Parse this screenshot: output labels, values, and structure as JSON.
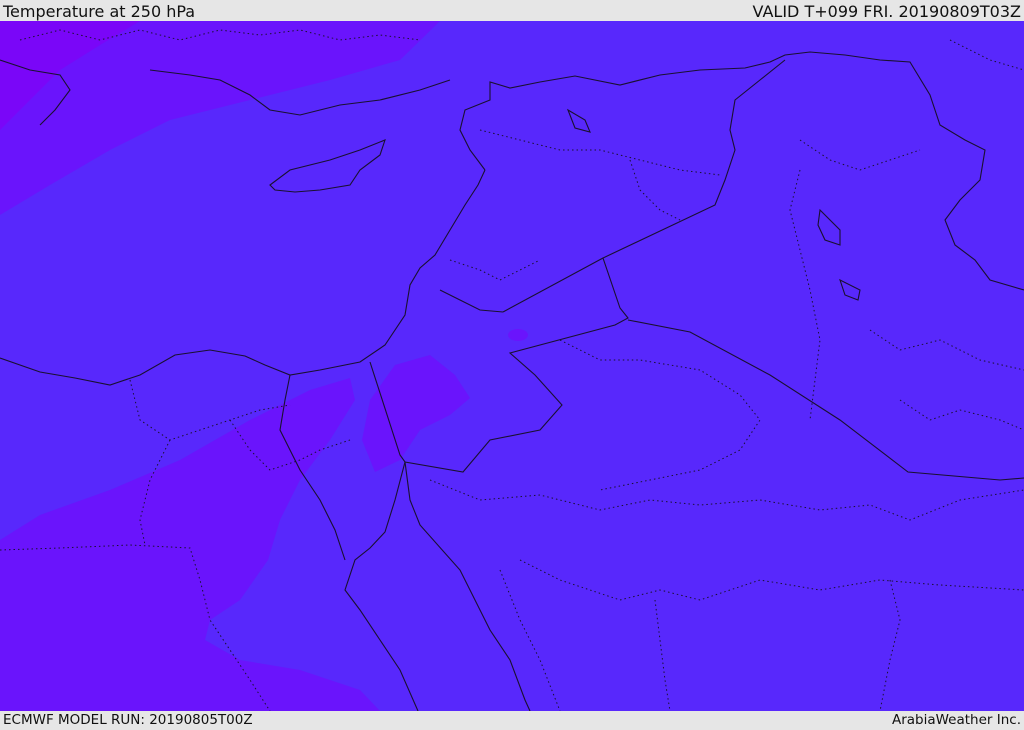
{
  "header": {
    "title": "Temperature at 250 hPa",
    "valid_time": "VALID T+099 FRI. 20190809T03Z"
  },
  "footer": {
    "model_run": "ECMWF MODEL RUN: 20190805T00Z",
    "credit": "ArabiaWeather Inc."
  },
  "colors": {
    "field_main": "#5828fc",
    "field_warm_band": "#6a14fc",
    "field_warmest": "#7a06f8",
    "borders": "#1a1030",
    "bars": "#e6e6e6"
  }
}
